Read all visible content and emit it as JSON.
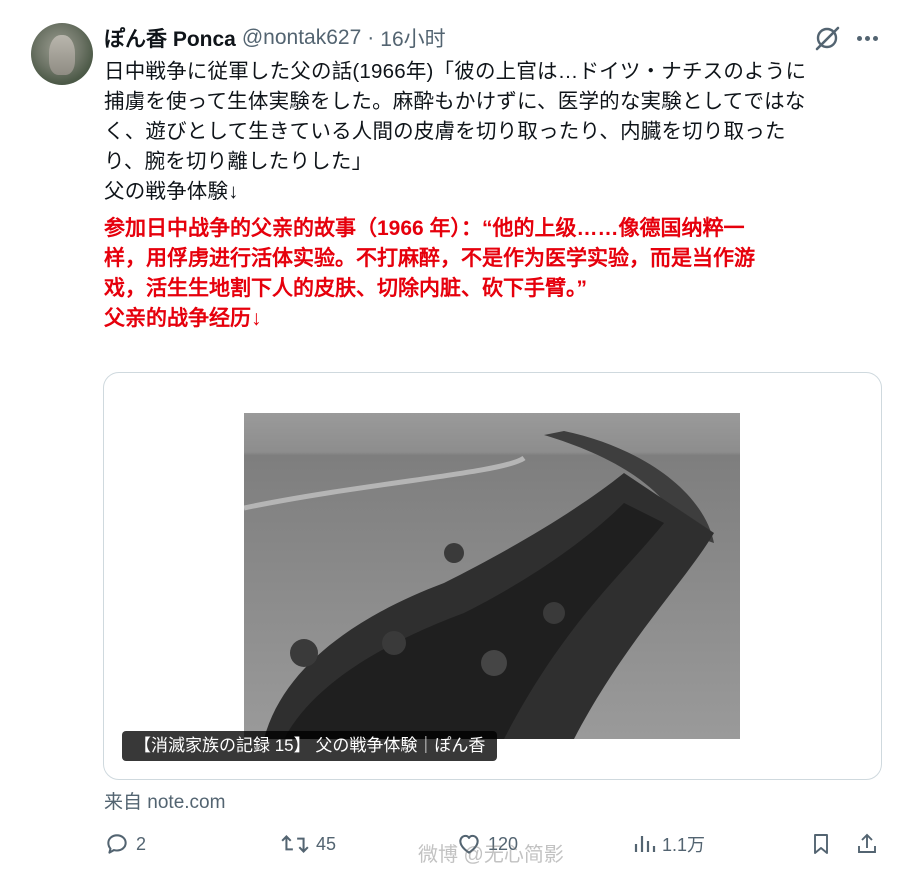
{
  "tweet": {
    "author": {
      "name": "ぽん香 Ponca",
      "handle": "@nontak627",
      "separator": "·",
      "time": "16小时"
    },
    "text_jp_lines": [
      "日中戦争に従軍した父の話(1966年)「彼の上官は…ドイツ・ナチスのように",
      "捕虜を使って生体実験をした。麻酔もかけずに、医学的な実験としてではな",
      "く、遊びとして生きている人間の皮膚を切り取ったり、内臓を切り取った",
      "り、腕を切り離したりした」",
      "父の戦争体験↓"
    ],
    "text_cn_lines": [
      "参加日中战争的父亲的故事（1966 年）：“他的上级……像德国纳粹一",
      "样，用俘虏进行活体实验。不打麻醉，不是作为医学实验，而是当作游",
      "戏，活生生地割下人的皮肤、切除内脏、砍下手臂。”",
      "父亲的战争经历↓"
    ],
    "card": {
      "caption": "【消滅家族の記録 15】 父の戦争体験｜ぽん香",
      "source": "来自 note.com"
    },
    "actions": {
      "replies": "2",
      "retweets": "45",
      "likes": "120",
      "views": "1.1万"
    },
    "watermark": "微博 @无心简影"
  },
  "icons": [
    "grok-icon",
    "more-icon",
    "reply-icon",
    "retweet-icon",
    "like-icon",
    "views-icon",
    "bookmark-icon",
    "share-icon"
  ],
  "colors": {
    "text": "#0f1419",
    "muted": "#536471",
    "red": "#e6000c",
    "border": "#cfd9de"
  }
}
